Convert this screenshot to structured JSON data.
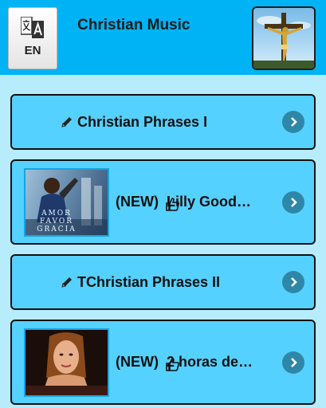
{
  "header": {
    "language_code": "EN",
    "title": "Christian Music",
    "language_icon": "translate-icon",
    "image_alt": "crucifix-image"
  },
  "items": [
    {
      "label": "Christian Phrases I",
      "icon": "pencil-icon",
      "action_icon": "chevron-right-icon"
    },
    {
      "label": "(NEW)  Lilly Good…",
      "icon": "thumbs-up-icon",
      "thumbnail": "album-cover",
      "thumbnail_text": "AMOR FAVOR GRACIA",
      "action_icon": "chevron-right-icon"
    },
    {
      "label": "TChristian Phrases II",
      "icon": "pencil-icon",
      "action_icon": "chevron-right-icon"
    },
    {
      "label": "(NEW)  2 horas de…",
      "icon": "thumbs-up-icon",
      "thumbnail": "singer-photo",
      "action_icon": "chevron-right-icon"
    }
  ],
  "colors": {
    "header_bg": "#00b3f5",
    "page_bg": "#b7ecfd",
    "item_bg": "#55d1ff",
    "chevron_bg": "#2f87a8"
  }
}
